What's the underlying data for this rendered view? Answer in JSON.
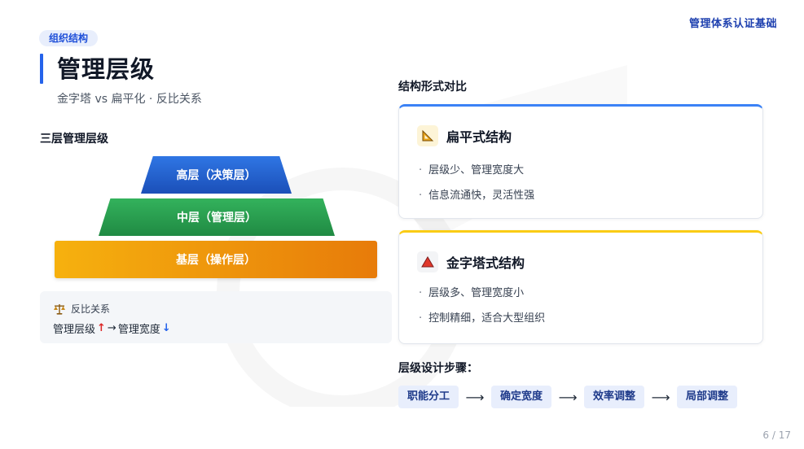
{
  "header": {
    "brand": "管理体系认证基础"
  },
  "section_tag": "组织结构",
  "title": "管理层级",
  "subtitle": "金字塔 vs 扁平化 · 反比关系",
  "left": {
    "heading": "三层管理层级",
    "pyramid": [
      {
        "label": "高层（决策层）"
      },
      {
        "label": "中层（管理层）"
      },
      {
        "label": "基层（操作层）"
      }
    ],
    "relation": {
      "title": "反比关系",
      "left_term": "管理层级",
      "up_arrow": "↑",
      "arrow": "→",
      "right_term": "管理宽度",
      "down_arrow": "↓"
    }
  },
  "right": {
    "heading": "结构形式对比",
    "cards": [
      {
        "title": "扁平式结构",
        "bullet": "·",
        "items": [
          "层级少、管理宽度大",
          "信息流通快，灵活性强"
        ]
      },
      {
        "title": "金字塔式结构",
        "bullet": "·",
        "items": [
          "层级多、管理宽度小",
          "控制精细，适合大型组织"
        ]
      }
    ],
    "steps_heading": "层级设计步骤：",
    "step_arrow": "⟶",
    "steps": [
      "职能分工",
      "确定宽度",
      "效率调整",
      "局部调整"
    ]
  },
  "page_number": "6 / 17",
  "colors": {
    "accent": "#2563eb",
    "top_tier": "#2563eb",
    "mid_tier": "#2a9d4c",
    "base_tier": "#f29c0d",
    "flat_card_border": "#3b82f6",
    "pyramid_card_border": "#facc15"
  },
  "icons": {
    "flat": "set-square-icon",
    "pyramid": "triangle-icon",
    "relation": "scale-icon"
  }
}
